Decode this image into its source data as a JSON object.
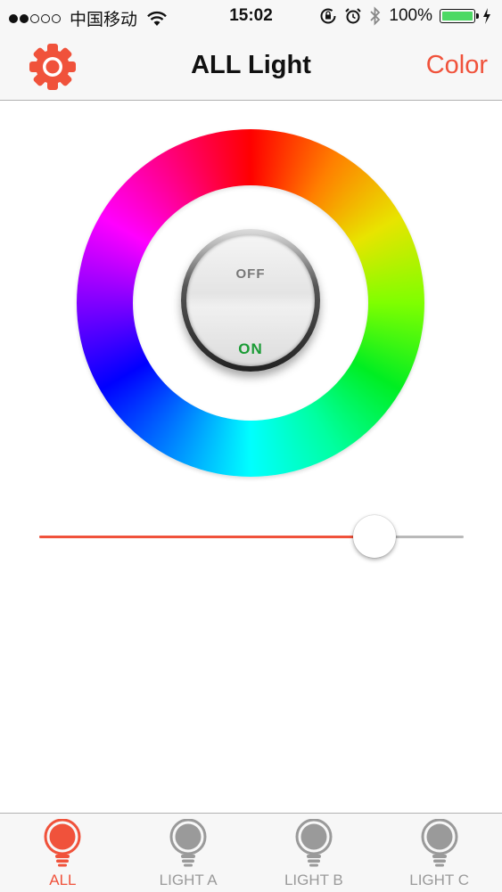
{
  "status_bar": {
    "carrier": "中国移动",
    "time": "15:02",
    "battery": "100%",
    "icons": [
      "signal-icon",
      "wifi-icon",
      "rotation-lock-icon",
      "alarm-icon",
      "bluetooth-icon",
      "battery-icon",
      "charging-icon"
    ]
  },
  "nav": {
    "title": "ALL Light",
    "right_label": "Color",
    "left_icon": "gear-icon"
  },
  "power_switch": {
    "off_label": "OFF",
    "on_label": "ON"
  },
  "brightness_slider": {
    "value": 0.79
  },
  "tabs": [
    {
      "label": "ALL",
      "icon": "bulb-icon",
      "active": true
    },
    {
      "label": "LIGHT A",
      "icon": "bulb-icon",
      "active": false
    },
    {
      "label": "LIGHT B",
      "icon": "bulb-icon",
      "active": false
    },
    {
      "label": "LIGHT C",
      "icon": "bulb-icon",
      "active": false
    }
  ],
  "colors": {
    "accent": "#f0523b",
    "inactive": "#9a9a9a",
    "on_green": "#1a9b35",
    "battery_green": "#4cd964"
  }
}
